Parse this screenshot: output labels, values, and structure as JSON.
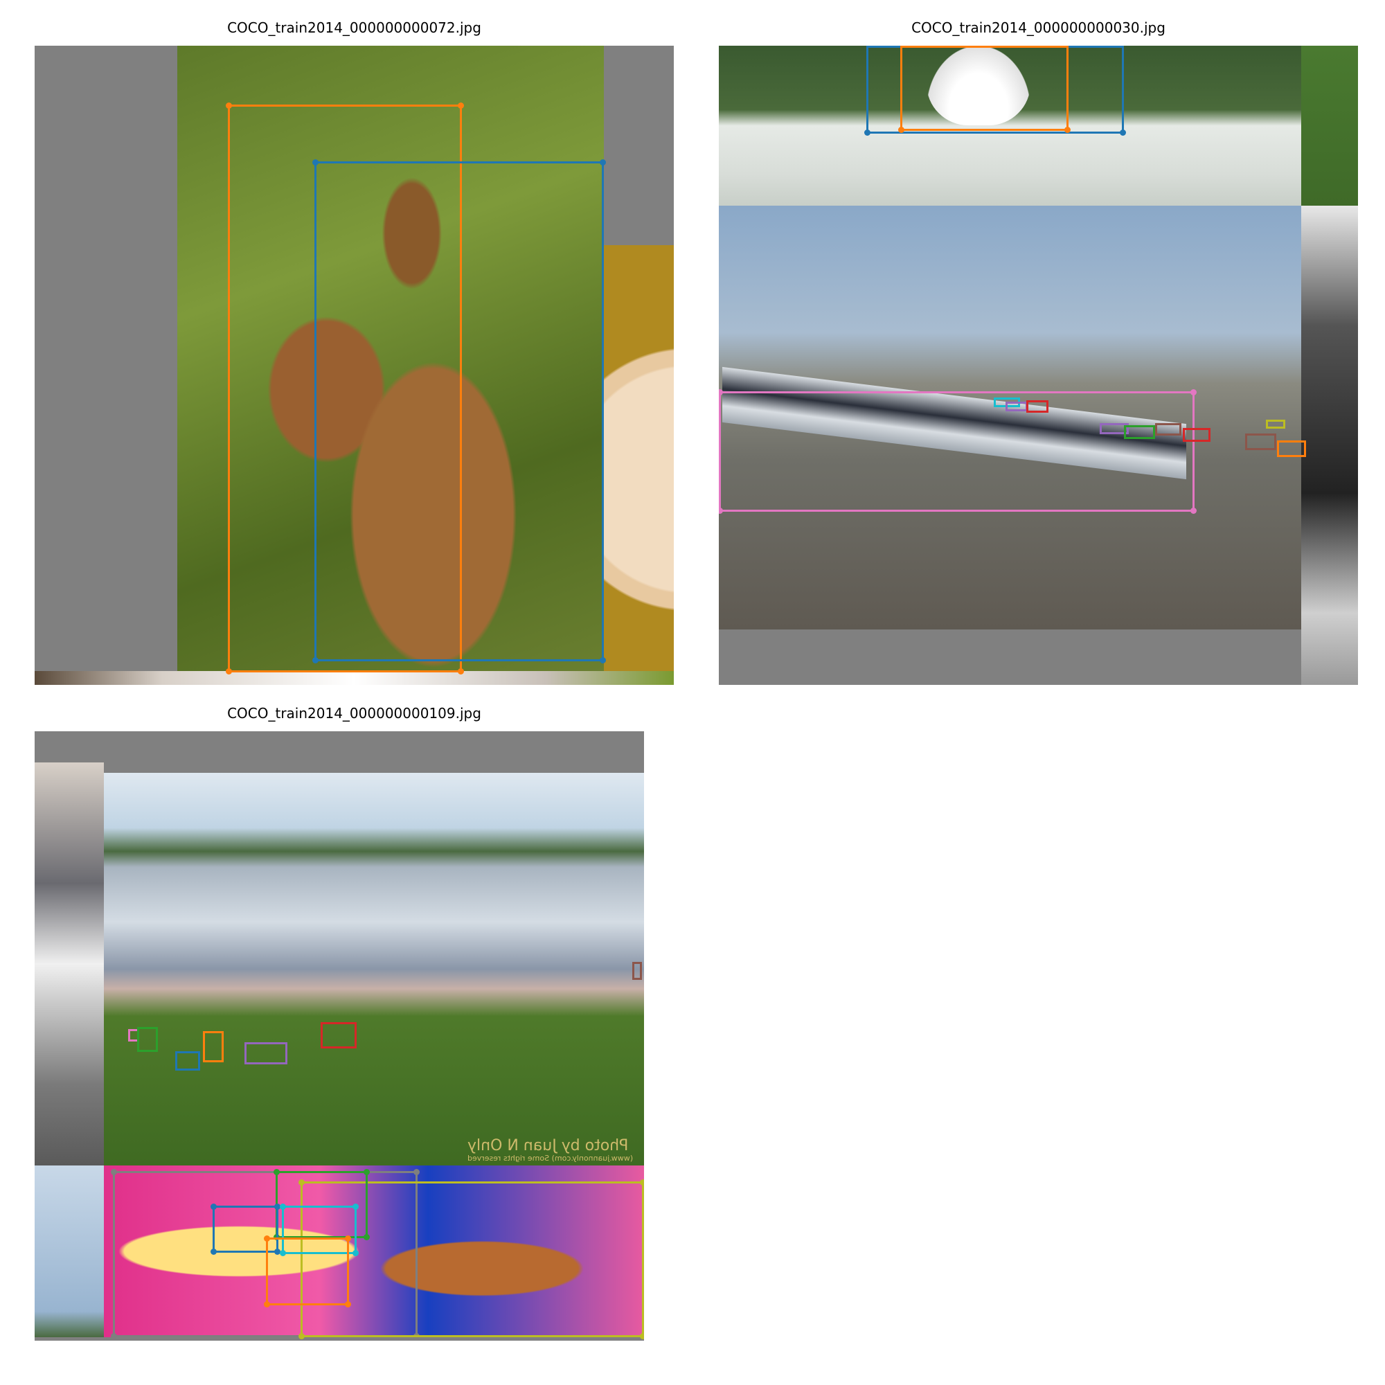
{
  "panels": [
    {
      "title": "COCO_train2014_000000000072.jpg"
    },
    {
      "title": "COCO_train2014_000000000030.jpg"
    },
    {
      "title": "COCO_train2014_000000000109.jpg"
    }
  ],
  "watermark": {
    "line1": "Photo by Juan N Only",
    "line2": "(www.juannonly.com) Some rights reserved"
  },
  "colors": {
    "blue": "#1f77b4",
    "orange": "#ff7f0e",
    "green": "#2ca02c",
    "red": "#d62728",
    "purple": "#9467bd",
    "brown": "#8c564b",
    "pink": "#e377c2",
    "gray": "#7f7f7f",
    "olive": "#bcbd22",
    "cyan": "#17becf"
  }
}
